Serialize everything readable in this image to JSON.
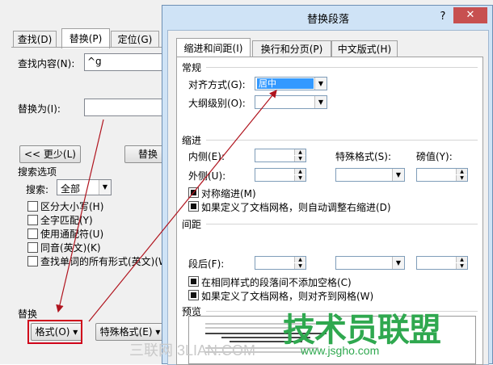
{
  "find_replace": {
    "tabs": [
      {
        "label": "查找(D)"
      },
      {
        "label": "替换(P)"
      },
      {
        "label": "定位(G)"
      }
    ],
    "find_label": "查找内容(N):",
    "find_value": "^g",
    "replace_label": "替换为(I):",
    "replace_value": "",
    "less_button": "<< 更少(L)",
    "replace_button": "替换",
    "search_options_title": "搜索选项",
    "search_label": "搜索:",
    "search_value": "全部",
    "options": [
      {
        "label": "区分大小写(H)"
      },
      {
        "label": "全字匹配(Y)"
      },
      {
        "label": "使用通配符(U)"
      },
      {
        "label": "同音(英文)(K)"
      },
      {
        "label": "查找单词的所有形式(英文)(W)"
      }
    ],
    "replace_section_title": "替换",
    "format_button": "格式(O) ▾",
    "special_button": "特殊格式(E) ▾"
  },
  "paragraph_dialog": {
    "title": "替换段落",
    "help": "?",
    "close": "✕",
    "tabs": [
      {
        "label": "缩进和间距(I)"
      },
      {
        "label": "换行和分页(P)"
      },
      {
        "label": "中文版式(H)"
      }
    ],
    "general_title": "常规",
    "alignment_label": "对齐方式(G):",
    "alignment_value": "居中",
    "outline_label": "大纲级别(O):",
    "outline_value": "",
    "indent_title": "缩进",
    "inside_label": "内侧(E):",
    "outside_label": "外侧(U):",
    "special_label": "特殊格式(S):",
    "measure_label": "磅值(Y):",
    "mirror_label": "对称缩进(M)",
    "auto_adjust_label": "如果定义了文档网格，则自动调整右缩进(D)",
    "spacing_title": "间距",
    "after_label": "段后(F):",
    "no_space_label": "在相同样式的段落间不添加空格(C)",
    "snap_grid_label": "如果定义了文档网格，则对齐到网格(W)",
    "preview_title": "预览"
  },
  "watermark": {
    "brand": "技术员联盟",
    "url": "www.jsgho.com",
    "grey": "三联网 3LIAN.COM"
  }
}
